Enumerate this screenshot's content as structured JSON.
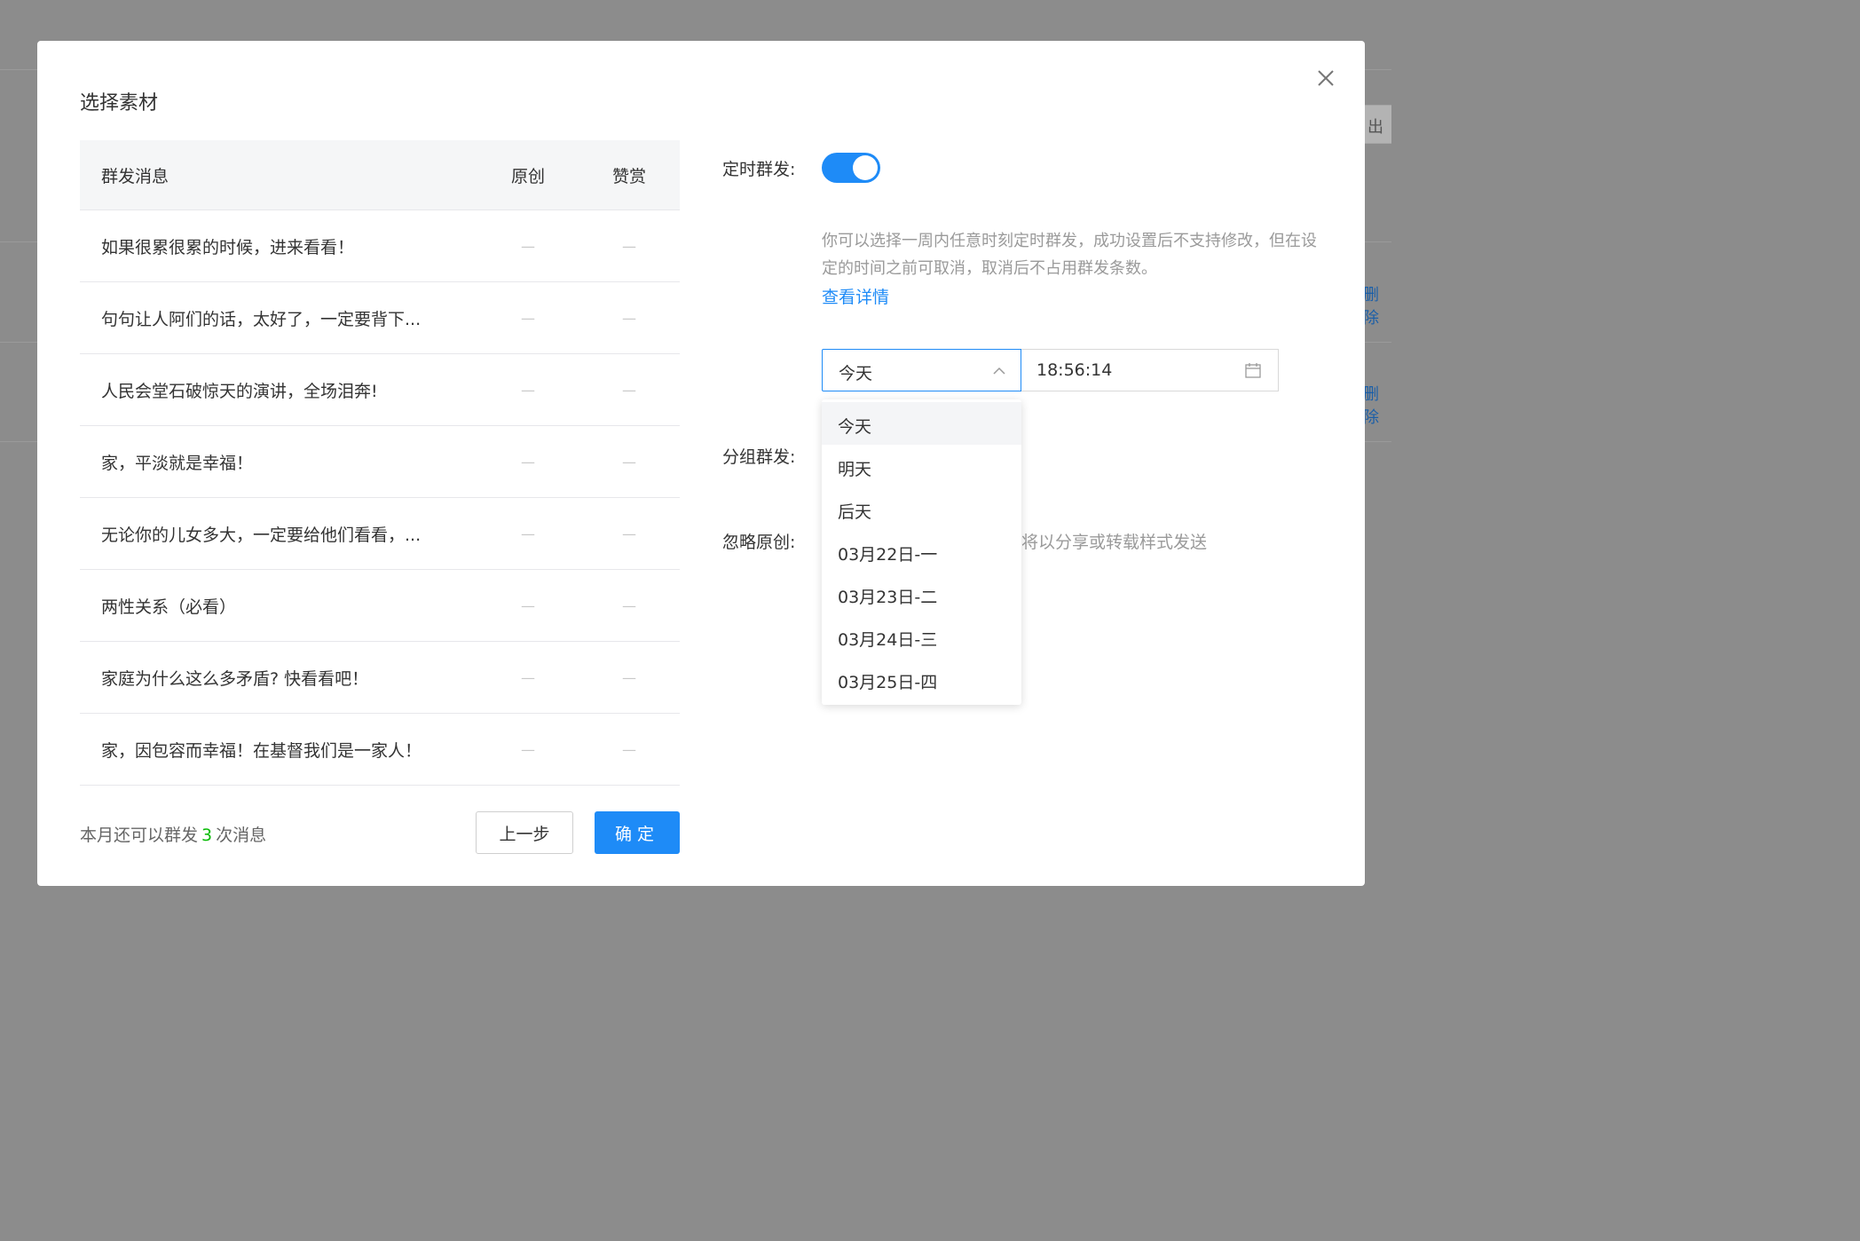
{
  "background": {
    "edge_button": "出",
    "edge_links": [
      "删除",
      "删除"
    ]
  },
  "modal": {
    "title": "选择素材",
    "close_icon": "close-icon"
  },
  "table": {
    "headers": {
      "title": "群发消息",
      "original": "原创",
      "praise": "赞赏"
    },
    "rows": [
      {
        "title": "如果很累很累的时候，进来看看！",
        "original": "—",
        "praise": "—"
      },
      {
        "title": "句句让人阿们的话，太好了，一定要背下...",
        "original": "—",
        "praise": "—"
      },
      {
        "title": "人民会堂石破惊天的演讲，全场泪奔!",
        "original": "—",
        "praise": "—"
      },
      {
        "title": "家，平淡就是幸福！",
        "original": "—",
        "praise": "—"
      },
      {
        "title": "无论你的儿女多大，一定要给他们看看，...",
        "original": "—",
        "praise": "—"
      },
      {
        "title": "两性关系（必看）",
        "original": "—",
        "praise": "—"
      },
      {
        "title": "家庭为什么这么多矛盾? 快看看吧！",
        "original": "—",
        "praise": "—"
      },
      {
        "title": "家，因包容而幸福！在基督我们是一家人！",
        "original": "—",
        "praise": "—"
      }
    ]
  },
  "footer": {
    "note_prefix": "本月还可以群发",
    "count": "3",
    "note_suffix": "次消息",
    "prev_label": "上一步",
    "ok_label": "确定"
  },
  "settings": {
    "scheduled_label": "定时群发:",
    "scheduled_enabled": true,
    "description": "你可以选择一周内任意时刻定时群发，成功设置后不支持修改，但在设定的时间之前可取消，取消后不占用群发条数。",
    "detail_link": "查看详情",
    "date_value": "今天",
    "time_value": "18:56:14",
    "group_label": "分组群发:",
    "ignore_label": "忽略原创:",
    "ignore_hint": "将以分享或转载样式发送",
    "accent_color": "#1e8bf7",
    "count_color": "#09bb07"
  },
  "dropdown": {
    "options": [
      "今天",
      "明天",
      "后天",
      "03月22日-一",
      "03月23日-二",
      "03月24日-三",
      "03月25日-四"
    ]
  }
}
